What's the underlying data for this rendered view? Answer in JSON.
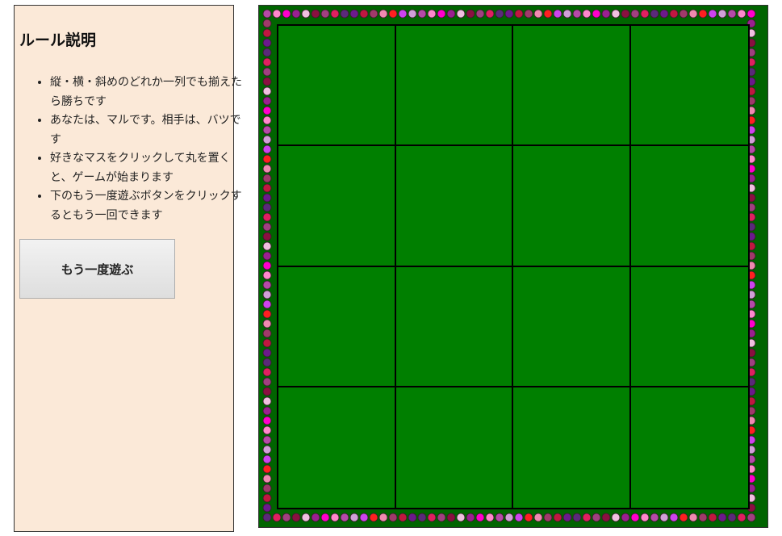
{
  "rules": {
    "title": "ルール説明",
    "items": [
      "縦・横・斜めのどれか一列でも揃えたら勝ちです",
      "あなたは、マルです。相手は、バツです",
      "好きなマスをクリックして丸を置くと、ゲームが始まります",
      "下のもう一度遊ぶボタンをクリックするともう一回できます"
    ]
  },
  "replay_button": {
    "label": "もう一度遊ぶ"
  },
  "board": {
    "rows": 4,
    "cols": 4,
    "cells": [
      [
        "",
        "",
        "",
        ""
      ],
      [
        "",
        "",
        "",
        ""
      ],
      [
        "",
        "",
        "",
        ""
      ],
      [
        "",
        "",
        "",
        ""
      ]
    ],
    "colors": {
      "cell_fill": "#007f00",
      "frame_fill": "#006400",
      "grid_lines": "#000000"
    },
    "bead_colors": [
      "#a03a6a",
      "#ff00cc",
      "#6b1a8c",
      "#b54aa8",
      "#e02060",
      "#cc44ee",
      "#8a1040",
      "#f08ab0",
      "#9a2090",
      "#c01840",
      "#ff88cc",
      "#5a2a7a",
      "#d0a0d8",
      "#a04080",
      "#ff2020",
      "#f0c0e0"
    ]
  }
}
